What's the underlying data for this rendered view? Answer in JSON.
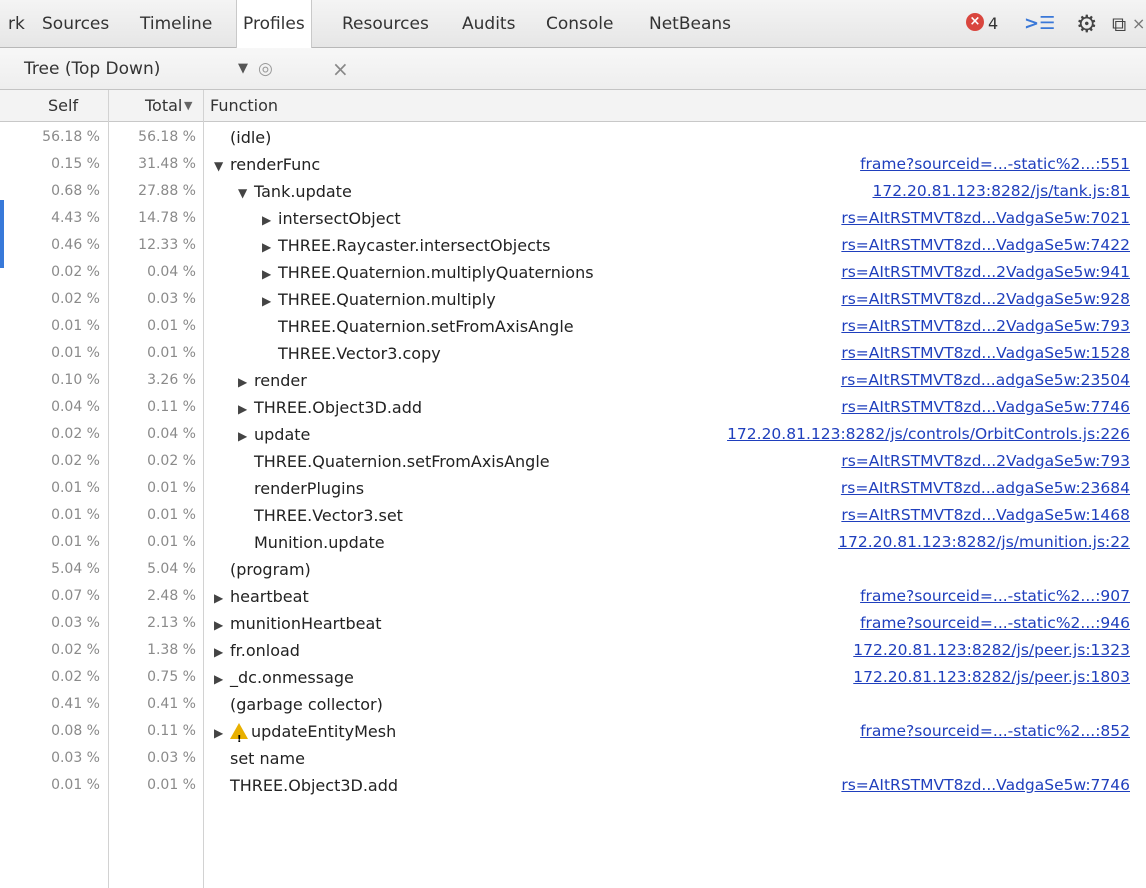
{
  "tabs": [
    {
      "label": "rk",
      "active": false
    },
    {
      "label": "Sources",
      "active": false
    },
    {
      "label": "Timeline",
      "active": false
    },
    {
      "label": "Profiles",
      "active": true
    },
    {
      "label": "Resources",
      "active": false
    },
    {
      "label": "Audits",
      "active": false
    },
    {
      "label": "Console",
      "active": false
    },
    {
      "label": "NetBeans",
      "active": false
    }
  ],
  "toolbar": {
    "error_count": "4",
    "console_icon": "console-drawer-icon",
    "settings_icon": "gear-icon",
    "dock_icon": "dock-icon",
    "close_icon": "close-icon"
  },
  "subbar": {
    "view_label": "Tree (Top Down)",
    "dropdown_icon": "chevron-down-icon",
    "focus_icon": "eye-icon",
    "clear_icon": "close-icon"
  },
  "columns": {
    "self": "Self",
    "total": "Total",
    "function": "Function"
  },
  "colors": {
    "link": "#1f3fbd",
    "error": "#d9463e",
    "warning": "#e8b000"
  },
  "rows": [
    {
      "self": "56.18 %",
      "total": "56.18 %",
      "depth": 0,
      "expand": "",
      "warn": false,
      "name": "(idle)",
      "url": ""
    },
    {
      "self": "0.15 %",
      "total": "31.48 %",
      "depth": 0,
      "expand": "down",
      "warn": false,
      "name": "renderFunc",
      "url": "frame?sourceid=...-static%2...:551"
    },
    {
      "self": "0.68 %",
      "total": "27.88 %",
      "depth": 1,
      "expand": "down",
      "warn": false,
      "name": "Tank.update",
      "url": "172.20.81.123:8282/js/tank.js:81"
    },
    {
      "self": "4.43 %",
      "total": "14.78 %",
      "depth": 2,
      "expand": "right",
      "warn": false,
      "name": "intersectObject",
      "url": "rs=AItRSTMVT8zd...VadgaSe5w:7021"
    },
    {
      "self": "0.46 %",
      "total": "12.33 %",
      "depth": 2,
      "expand": "right",
      "warn": false,
      "name": "THREE.Raycaster.intersectObjects",
      "url": "rs=AItRSTMVT8zd...VadgaSe5w:7422"
    },
    {
      "self": "0.02 %",
      "total": "0.04 %",
      "depth": 2,
      "expand": "right",
      "warn": false,
      "name": "THREE.Quaternion.multiplyQuaternions",
      "url": "rs=AItRSTMVT8zd...2VadgaSe5w:941"
    },
    {
      "self": "0.02 %",
      "total": "0.03 %",
      "depth": 2,
      "expand": "right",
      "warn": false,
      "name": "THREE.Quaternion.multiply",
      "url": "rs=AItRSTMVT8zd...2VadgaSe5w:928"
    },
    {
      "self": "0.01 %",
      "total": "0.01 %",
      "depth": 2,
      "expand": "",
      "warn": false,
      "name": "THREE.Quaternion.setFromAxisAngle",
      "url": "rs=AItRSTMVT8zd...2VadgaSe5w:793"
    },
    {
      "self": "0.01 %",
      "total": "0.01 %",
      "depth": 2,
      "expand": "",
      "warn": false,
      "name": "THREE.Vector3.copy",
      "url": "rs=AItRSTMVT8zd...VadgaSe5w:1528"
    },
    {
      "self": "0.10 %",
      "total": "3.26 %",
      "depth": 1,
      "expand": "right",
      "warn": false,
      "name": "render",
      "url": "rs=AItRSTMVT8zd...adgaSe5w:23504"
    },
    {
      "self": "0.04 %",
      "total": "0.11 %",
      "depth": 1,
      "expand": "right",
      "warn": false,
      "name": "THREE.Object3D.add",
      "url": "rs=AItRSTMVT8zd...VadgaSe5w:7746"
    },
    {
      "self": "0.02 %",
      "total": "0.04 %",
      "depth": 1,
      "expand": "right",
      "warn": false,
      "name": "update",
      "url": "172.20.81.123:8282/js/controls/OrbitControls.js:226"
    },
    {
      "self": "0.02 %",
      "total": "0.02 %",
      "depth": 1,
      "expand": "",
      "warn": false,
      "name": "THREE.Quaternion.setFromAxisAngle",
      "url": "rs=AItRSTMVT8zd...2VadgaSe5w:793"
    },
    {
      "self": "0.01 %",
      "total": "0.01 %",
      "depth": 1,
      "expand": "",
      "warn": false,
      "name": "renderPlugins",
      "url": "rs=AItRSTMVT8zd...adgaSe5w:23684"
    },
    {
      "self": "0.01 %",
      "total": "0.01 %",
      "depth": 1,
      "expand": "",
      "warn": false,
      "name": "THREE.Vector3.set",
      "url": "rs=AItRSTMVT8zd...VadgaSe5w:1468"
    },
    {
      "self": "0.01 %",
      "total": "0.01 %",
      "depth": 1,
      "expand": "",
      "warn": false,
      "name": "Munition.update",
      "url": "172.20.81.123:8282/js/munition.js:22"
    },
    {
      "self": "5.04 %",
      "total": "5.04 %",
      "depth": 0,
      "expand": "",
      "warn": false,
      "name": "(program)",
      "url": ""
    },
    {
      "self": "0.07 %",
      "total": "2.48 %",
      "depth": 0,
      "expand": "right",
      "warn": false,
      "name": "heartbeat",
      "url": "frame?sourceid=...-static%2...:907"
    },
    {
      "self": "0.03 %",
      "total": "2.13 %",
      "depth": 0,
      "expand": "right",
      "warn": false,
      "name": "munitionHeartbeat",
      "url": "frame?sourceid=...-static%2...:946"
    },
    {
      "self": "0.02 %",
      "total": "1.38 %",
      "depth": 0,
      "expand": "right",
      "warn": false,
      "name": "fr.onload",
      "url": "172.20.81.123:8282/js/peer.js:1323"
    },
    {
      "self": "0.02 %",
      "total": "0.75 %",
      "depth": 0,
      "expand": "right",
      "warn": false,
      "name": "_dc.onmessage",
      "url": "172.20.81.123:8282/js/peer.js:1803"
    },
    {
      "self": "0.41 %",
      "total": "0.41 %",
      "depth": 0,
      "expand": "",
      "warn": false,
      "name": "(garbage collector)",
      "url": ""
    },
    {
      "self": "0.08 %",
      "total": "0.11 %",
      "depth": 0,
      "expand": "right",
      "warn": true,
      "name": "updateEntityMesh",
      "url": "frame?sourceid=...-static%2...:852"
    },
    {
      "self": "0.03 %",
      "total": "0.03 %",
      "depth": 0,
      "expand": "",
      "warn": false,
      "name": "set name",
      "url": ""
    },
    {
      "self": "0.01 %",
      "total": "0.01 %",
      "depth": 0,
      "expand": "",
      "warn": false,
      "name": "THREE.Object3D.add",
      "url": "rs=AItRSTMVT8zd...VadgaSe5w:7746"
    }
  ]
}
